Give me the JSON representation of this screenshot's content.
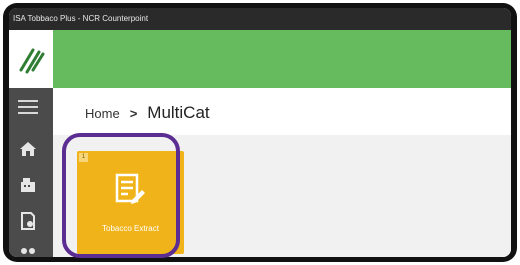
{
  "window": {
    "title": "ISA Tobbaco Plus - NCR Counterpoint"
  },
  "colors": {
    "banner": "#66bb5e",
    "sidebar": "#4b4b4b",
    "tile": "#f0b31a",
    "highlight": "#5b2c91"
  },
  "sidebar": {
    "icons": [
      "app-logo-icon",
      "menu-icon",
      "home-icon",
      "register-icon",
      "document-edit-icon",
      "users-icon"
    ]
  },
  "breadcrumb": {
    "home": "Home",
    "separator": ">",
    "current": "MultiCat"
  },
  "tiles": [
    {
      "badge": "1",
      "icon": "document-edit-icon",
      "label": "Tobacco Extract"
    }
  ]
}
